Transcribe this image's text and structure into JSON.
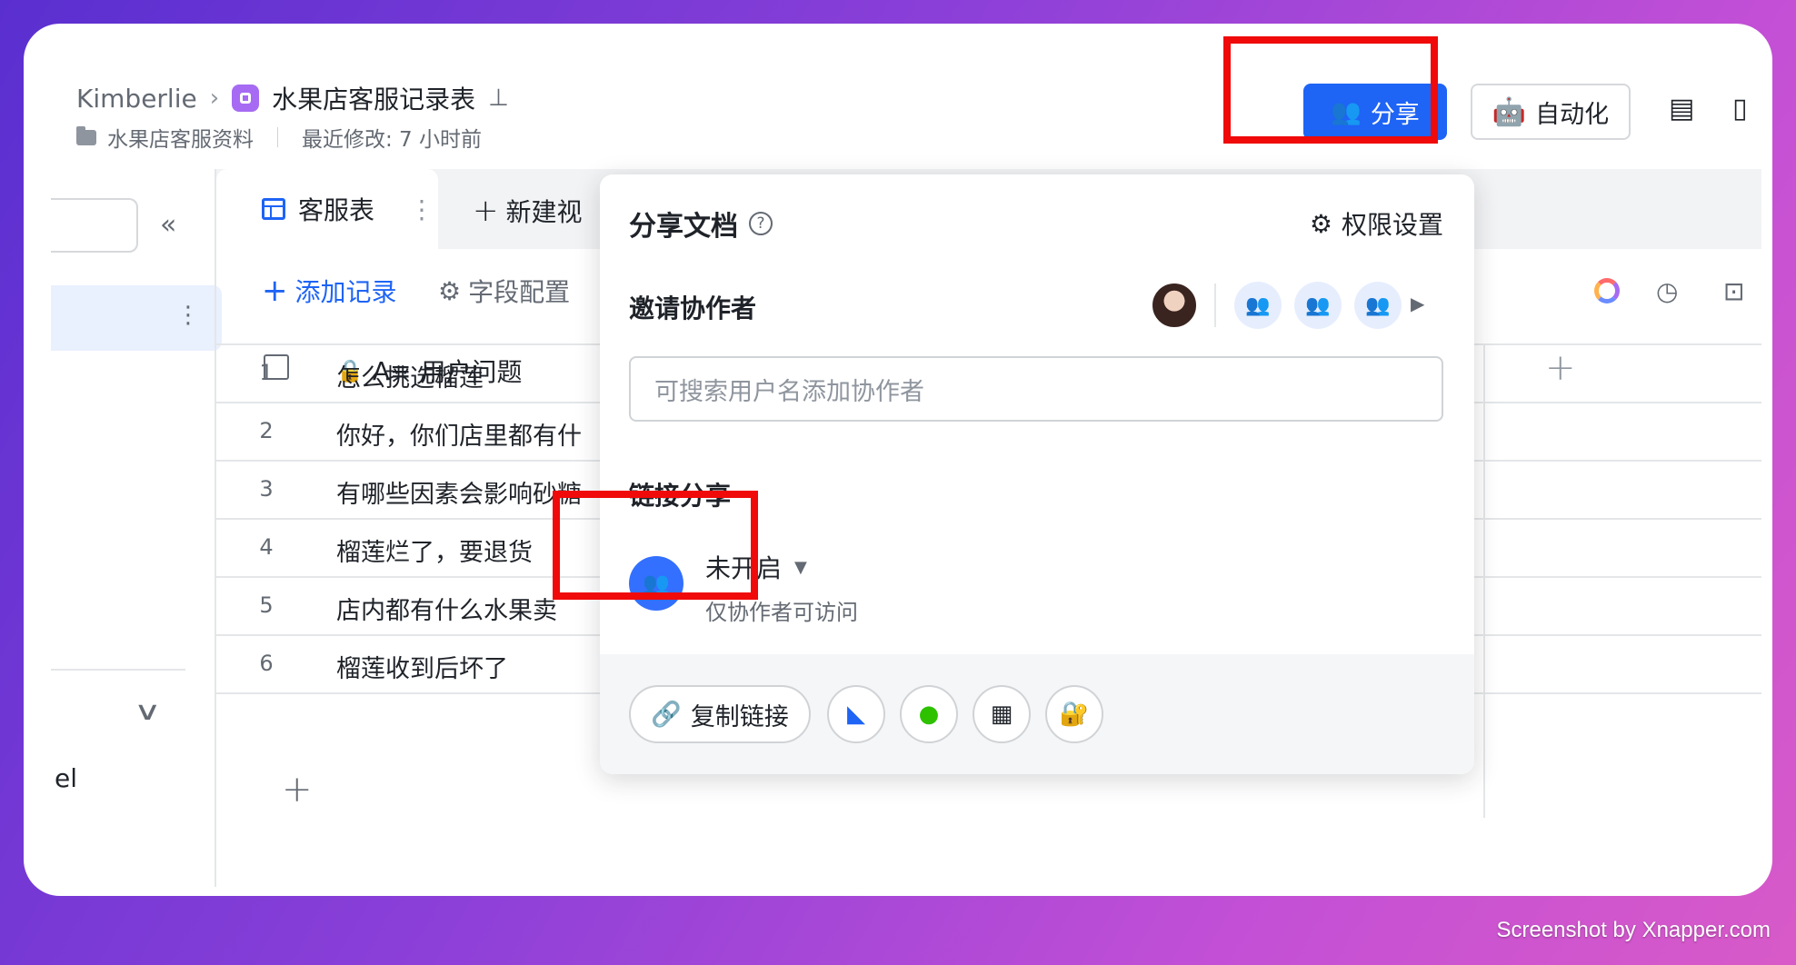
{
  "header": {
    "user": "Kimberlie",
    "doc_title": "水果店客服记录表",
    "folder": "水果店客服资料",
    "last_modified": "最近修改: 7 小时前"
  },
  "actions": {
    "share_label": "分享",
    "automation_label": "自动化"
  },
  "tabs": {
    "active_label": "客服表",
    "new_view_label": "新建视"
  },
  "toolbar": {
    "add_record_label": "添加记录",
    "field_config_label": "字段配置"
  },
  "table": {
    "column_title": "用户问题",
    "rows": [
      {
        "num": "1",
        "text": "怎么挑选榴莲"
      },
      {
        "num": "2",
        "text": "你好，你们店里都有什"
      },
      {
        "num": "3",
        "text": "有哪些因素会影响砂糖"
      },
      {
        "num": "4",
        "text": "榴莲烂了，要退货"
      },
      {
        "num": "5",
        "text": "店内都有什么水果卖"
      },
      {
        "num": "6",
        "text": "榴莲收到后坏了"
      }
    ]
  },
  "sidebar": {
    "truncated_label": "el"
  },
  "share_popover": {
    "title": "分享文档",
    "permission_label": "权限设置",
    "invite_title": "邀请协作者",
    "search_placeholder": "可搜索用户名添加协作者",
    "link_share_title": "链接分享",
    "link_state": "未开启",
    "link_desc": "仅协作者可访问",
    "copy_link_label": "复制链接"
  },
  "watermark": "Screenshot by Xnapper.com",
  "colors": {
    "accent": "#1e64f5",
    "highlight": "#f00a0a"
  }
}
